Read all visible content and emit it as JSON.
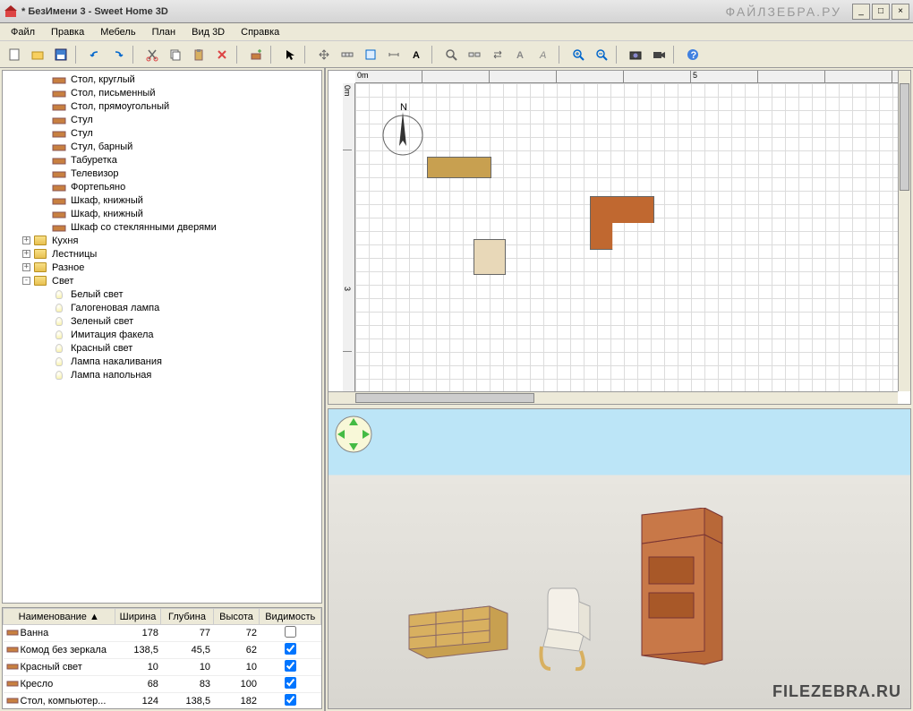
{
  "window": {
    "title": "* БезИмени 3 - Sweet Home 3D"
  },
  "menu": [
    "Файл",
    "Правка",
    "Мебель",
    "План",
    "Вид 3D",
    "Справка"
  ],
  "catalog_items": [
    {
      "label": "Стол, круглый",
      "indent": 2,
      "kind": "item"
    },
    {
      "label": "Стол, письменный",
      "indent": 2,
      "kind": "item"
    },
    {
      "label": "Стол, прямоугольный",
      "indent": 2,
      "kind": "item"
    },
    {
      "label": "Стул",
      "indent": 2,
      "kind": "item"
    },
    {
      "label": "Стул",
      "indent": 2,
      "kind": "item"
    },
    {
      "label": "Стул, барный",
      "indent": 2,
      "kind": "item"
    },
    {
      "label": "Табуретка",
      "indent": 2,
      "kind": "item"
    },
    {
      "label": "Телевизор",
      "indent": 2,
      "kind": "item"
    },
    {
      "label": "Фортепьяно",
      "indent": 2,
      "kind": "item"
    },
    {
      "label": "Шкаф, книжный",
      "indent": 2,
      "kind": "item"
    },
    {
      "label": "Шкаф, книжный",
      "indent": 2,
      "kind": "item"
    },
    {
      "label": "Шкаф со стеклянными дверями",
      "indent": 2,
      "kind": "item"
    },
    {
      "label": "Кухня",
      "indent": 1,
      "kind": "folder",
      "exp": "+"
    },
    {
      "label": "Лестницы",
      "indent": 1,
      "kind": "folder",
      "exp": "+"
    },
    {
      "label": "Разное",
      "indent": 1,
      "kind": "folder",
      "exp": "+"
    },
    {
      "label": "Свет",
      "indent": 1,
      "kind": "folder",
      "exp": "-"
    },
    {
      "label": "Белый свет",
      "indent": 2,
      "kind": "bulb"
    },
    {
      "label": "Галогеновая лампа",
      "indent": 2,
      "kind": "bulb"
    },
    {
      "label": "Зеленый свет",
      "indent": 2,
      "kind": "bulb"
    },
    {
      "label": "Имитация факела",
      "indent": 2,
      "kind": "bulb"
    },
    {
      "label": "Красный свет",
      "indent": 2,
      "kind": "bulb"
    },
    {
      "label": "Лампа накаливания",
      "indent": 2,
      "kind": "bulb"
    },
    {
      "label": "Лампа напольная",
      "indent": 2,
      "kind": "bulb"
    }
  ],
  "table": {
    "headers": [
      "Наименование ▲",
      "Ширина",
      "Глубина",
      "Высота",
      "Видимость"
    ],
    "rows": [
      {
        "name": "Ванна",
        "w": "178",
        "d": "77",
        "h": "72",
        "vis": false
      },
      {
        "name": "Комод без зеркала",
        "w": "138,5",
        "d": "45,5",
        "h": "62",
        "vis": true
      },
      {
        "name": "Красный свет",
        "w": "10",
        "d": "10",
        "h": "10",
        "vis": true
      },
      {
        "name": "Кресло",
        "w": "68",
        "d": "83",
        "h": "100",
        "vis": true
      },
      {
        "name": "Стол, компьютер...",
        "w": "124",
        "d": "138,5",
        "h": "182",
        "vis": true
      }
    ]
  },
  "ruler_h": [
    "0m",
    "",
    "",
    "",
    "",
    "5",
    "",
    ""
  ],
  "ruler_v": [
    "0m",
    "",
    "",
    "3",
    ""
  ],
  "compass_label": "N",
  "watermark": "FILEZEBRA.RU",
  "watermark_top": "ФАЙЛЗЕБРА.РУ"
}
